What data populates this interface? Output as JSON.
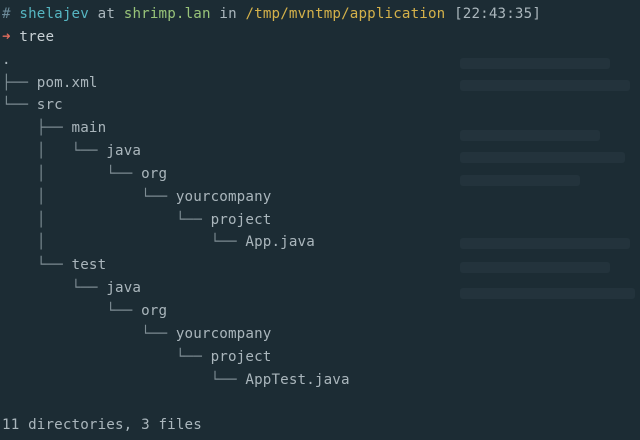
{
  "prompt": {
    "hash": "#",
    "user": "shelajev",
    "at": "at",
    "host": "shrimp.lan",
    "in": "in",
    "path": "/tmp/mvntmp/application",
    "time": "[22:43:35]"
  },
  "command": {
    "arrow": "➜",
    "text": "tree"
  },
  "tree": {
    "root": ".",
    "entries": [
      {
        "guide": "├── ",
        "name": "pom.xml"
      },
      {
        "guide": "└── ",
        "name": "src"
      },
      {
        "guide": "    ├── ",
        "name": "main"
      },
      {
        "guide": "    │   └── ",
        "name": "java"
      },
      {
        "guide": "    │       └── ",
        "name": "org"
      },
      {
        "guide": "    │           └── ",
        "name": "yourcompany"
      },
      {
        "guide": "    │               └── ",
        "name": "project"
      },
      {
        "guide": "    │                   └── ",
        "name": "App.java"
      },
      {
        "guide": "    └── ",
        "name": "test"
      },
      {
        "guide": "        └── ",
        "name": "java"
      },
      {
        "guide": "            └── ",
        "name": "org"
      },
      {
        "guide": "                └── ",
        "name": "yourcompany"
      },
      {
        "guide": "                    └── ",
        "name": "project"
      },
      {
        "guide": "                        └── ",
        "name": "AppTest.java"
      }
    ]
  },
  "summary": "11 directories, 3 files"
}
